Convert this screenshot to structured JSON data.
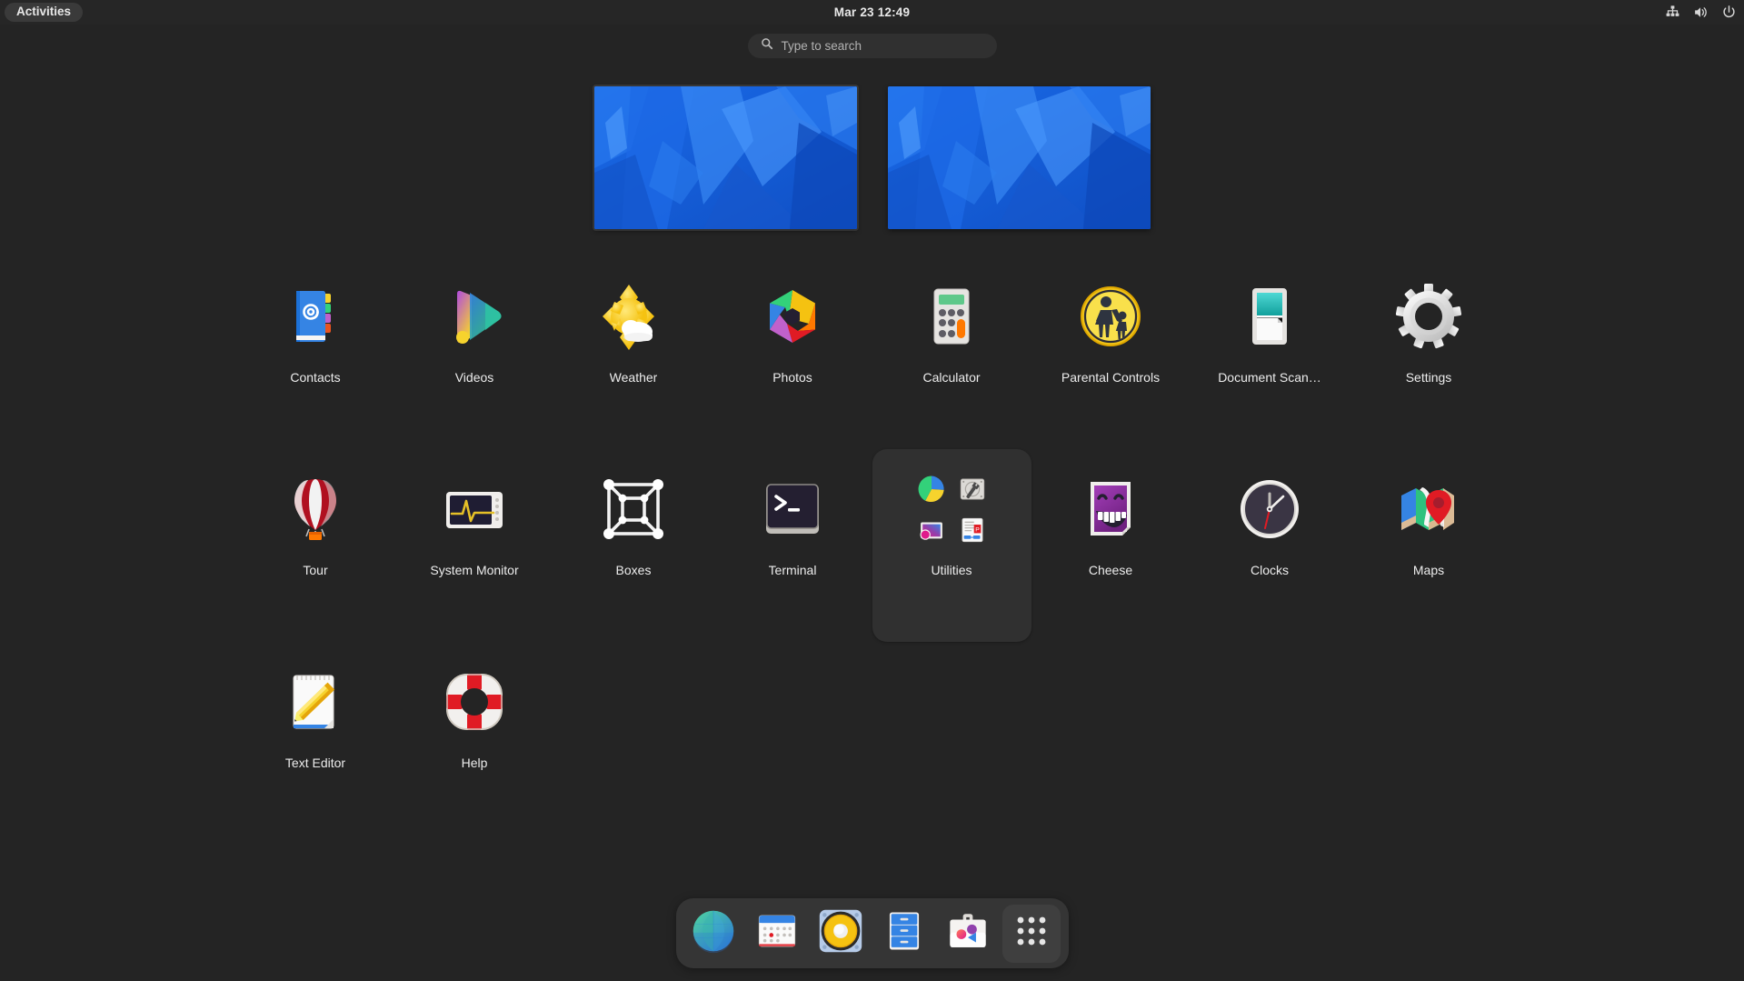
{
  "topbar": {
    "activities_label": "Activities",
    "clock": "Mar 23  12:49",
    "status_icons": [
      {
        "name": "network-wired-icon",
        "label": "Network"
      },
      {
        "name": "volume-icon",
        "label": "Volume"
      },
      {
        "name": "power-icon",
        "label": "Power Off / Log Out"
      }
    ]
  },
  "search": {
    "placeholder": "Type to search",
    "value": "",
    "icon": "search-icon"
  },
  "workspaces": [
    {
      "name": "workspace-1",
      "label": "Workspace 1",
      "active": true
    },
    {
      "name": "workspace-2",
      "label": "Workspace 2",
      "active": false
    }
  ],
  "app_grid": {
    "rows": [
      [
        {
          "label": "Contacts",
          "icon": "contacts-icon"
        },
        {
          "label": "Videos",
          "icon": "videos-icon"
        },
        {
          "label": "Weather",
          "icon": "weather-icon"
        },
        {
          "label": "Photos",
          "icon": "photos-icon"
        },
        {
          "label": "Calculator",
          "icon": "calculator-icon"
        },
        {
          "label": "Parental Controls",
          "icon": "parental-controls-icon"
        },
        {
          "label": "Document Scan…",
          "icon": "document-scanner-icon"
        },
        {
          "label": "Settings",
          "icon": "settings-gear-icon"
        }
      ],
      [
        {
          "label": "Tour",
          "icon": "tour-balloon-icon"
        },
        {
          "label": "System Monitor",
          "icon": "system-monitor-icon"
        },
        {
          "label": "Boxes",
          "icon": "boxes-icon"
        },
        {
          "label": "Terminal",
          "icon": "terminal-icon"
        },
        {
          "label": "Utilities",
          "icon": "folder-utilities",
          "is_folder": true,
          "contents": [
            "disk-usage-analyzer-icon",
            "disks-icon",
            "image-viewer-icon",
            "document-viewer-icon"
          ]
        },
        {
          "label": "Cheese",
          "icon": "cheese-icon"
        },
        {
          "label": "Clocks",
          "icon": "clocks-icon"
        },
        {
          "label": "Maps",
          "icon": "maps-icon"
        }
      ],
      [
        {
          "label": "Text Editor",
          "icon": "text-editor-icon"
        },
        {
          "label": "Help",
          "icon": "help-lifering-icon"
        }
      ]
    ]
  },
  "dock": {
    "items": [
      {
        "name": "dock-web",
        "label": "Web",
        "icon": "globe-icon"
      },
      {
        "name": "dock-calendar",
        "label": "Calendar",
        "icon": "calendar-icon"
      },
      {
        "name": "dock-music",
        "label": "Music",
        "icon": "speaker-icon"
      },
      {
        "name": "dock-files",
        "label": "Files",
        "icon": "file-cabinet-icon"
      },
      {
        "name": "dock-software",
        "label": "Software",
        "icon": "briefcase-icon"
      },
      {
        "name": "dock-show-apps",
        "label": "Show Apps",
        "icon": "app-grid-icon"
      }
    ]
  },
  "colors": {
    "desktop_bg": "#242424",
    "topbar_bg": "#262626",
    "dock_bg": "#353535",
    "folder_bg": "#303030",
    "search_bg": "#303030",
    "accent_blue": "#3584e4",
    "text": "#ececec"
  }
}
